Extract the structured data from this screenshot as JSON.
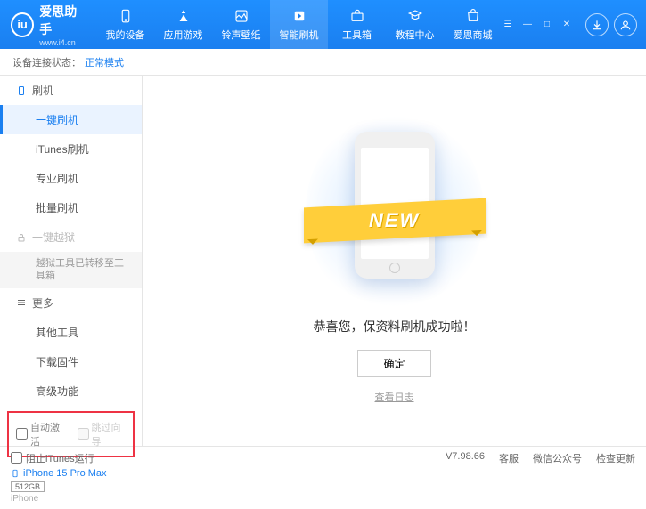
{
  "app": {
    "name": "爱思助手",
    "url": "www.i4.cn",
    "logo_letter": "iu"
  },
  "nav": [
    {
      "label": "我的设备",
      "icon": "device"
    },
    {
      "label": "应用游戏",
      "icon": "apps"
    },
    {
      "label": "铃声壁纸",
      "icon": "media"
    },
    {
      "label": "智能刷机",
      "icon": "flash"
    },
    {
      "label": "工具箱",
      "icon": "tools"
    },
    {
      "label": "教程中心",
      "icon": "tutorial"
    },
    {
      "label": "爱思商城",
      "icon": "shop"
    }
  ],
  "nav_active_index": 3,
  "status": {
    "label": "设备连接状态：",
    "value": "正常模式"
  },
  "sidebar": {
    "group_flash": "刷机",
    "items_flash": [
      "一键刷机",
      "iTunes刷机",
      "专业刷机",
      "批量刷机"
    ],
    "group_jailbreak": "一键越狱",
    "jailbreak_note": "越狱工具已转移至工具箱",
    "group_more": "更多",
    "items_more": [
      "其他工具",
      "下载固件",
      "高级功能"
    ]
  },
  "options": {
    "auto_activate": "自动激活",
    "skip_guide": "跳过向导"
  },
  "device": {
    "name": "iPhone 15 Pro Max",
    "storage": "512GB",
    "type": "iPhone"
  },
  "main": {
    "ribbon": "NEW",
    "success": "恭喜您，保资料刷机成功啦！",
    "ok": "确定",
    "view_log": "查看日志"
  },
  "footer": {
    "block_itunes": "阻止iTunes运行",
    "version": "V7.98.66",
    "links": [
      "客服",
      "微信公众号",
      "检查更新"
    ]
  }
}
